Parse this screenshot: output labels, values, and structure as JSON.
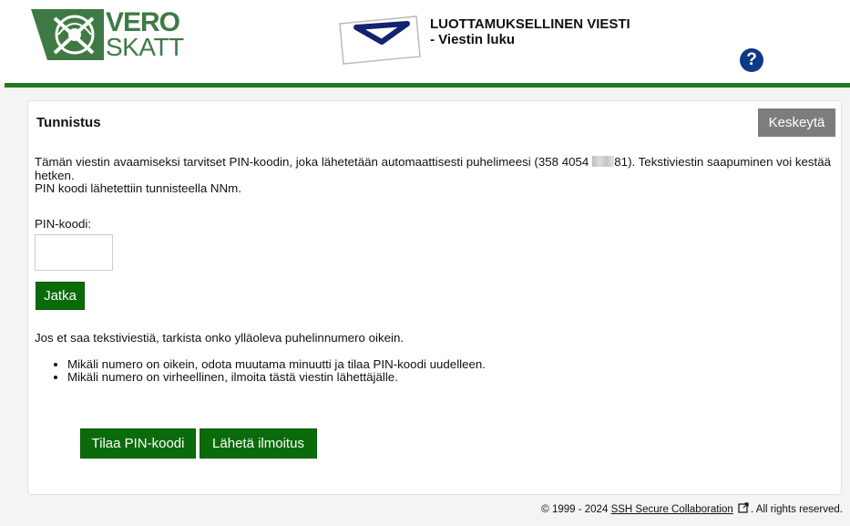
{
  "logo": {
    "line1": "VERO",
    "line2": "SKATT"
  },
  "header": {
    "title": "LUOTTAMUKSELLINEN VIESTI",
    "subtitle": "- Viestin luku",
    "help_label": "?"
  },
  "card": {
    "title": "Tunnistus",
    "cancel_label": "Keskeytä",
    "info_part1": "Tämän viestin avaamiseksi tarvitset PIN-koodin, joka lähetetään automaattisesti puhelimeesi (358 4054",
    "info_part2": "81). Tekstiviestin saapuminen voi kestää hetken.",
    "info_line2": "PIN koodi lähetettiin tunnisteella NNm.",
    "pin_label": "PIN-koodi:",
    "pin_value": "",
    "continue_label": "Jatka",
    "help_text": "Jos et saa tekstiviestiä, tarkista onko ylläoleva puhelinnumero oikein.",
    "bullets": [
      "Mikäli numero on oikein, odota muutama minuutti ja tilaa PIN-koodi uudelleen.",
      "Mikäli numero on virheellinen, ilmoita tästä viestin lähettäjälle."
    ],
    "order_pin_label": "Tilaa PIN-koodi",
    "send_notice_label": "Lähetä ilmoitus"
  },
  "footer": {
    "prefix": "© 1999 - 2024",
    "link_text": "SSH Secure Collaboration",
    "suffix": ". All rights reserved."
  },
  "colors": {
    "brand_green": "#1f7a1f",
    "button_green": "#0b6b0b",
    "help_blue": "#0e3a84",
    "cancel_gray": "#7d7d7d"
  }
}
